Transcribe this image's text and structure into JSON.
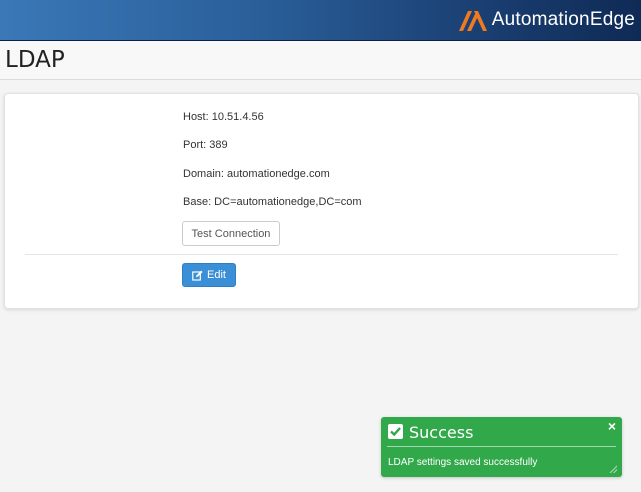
{
  "brand": {
    "name": "AutomationEdge",
    "logo_icon": "ae-chevron-logo-icon",
    "logo_color": "#f07a22"
  },
  "page": {
    "title": "LDAP"
  },
  "ldap": {
    "host": "Host: 10.51.4.56",
    "port": "Port: 389",
    "domain": "Domain: automationedge.com",
    "base": "Base: DC=automationedge,DC=com"
  },
  "actions": {
    "test_connection": "Test Connection",
    "edit": "Edit",
    "edit_icon": "edit-icon",
    "edit_color": "#3a8fd6"
  },
  "toast": {
    "title": "Success",
    "message": "LDAP settings saved successfully",
    "color": "#31a94a",
    "icon": "check-square-icon",
    "close": "×"
  }
}
